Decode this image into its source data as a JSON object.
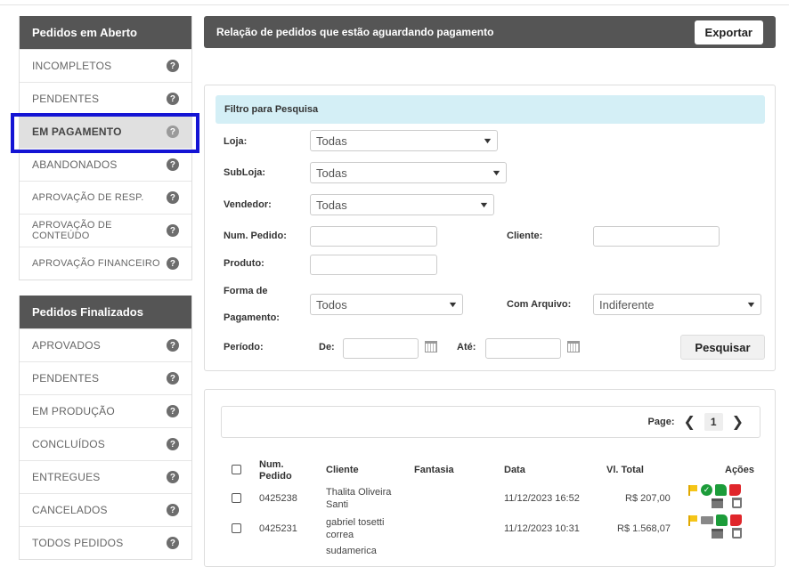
{
  "sidebar": {
    "open_orders": {
      "title": "Pedidos em Aberto",
      "items": [
        {
          "label": "INCOMPLETOS"
        },
        {
          "label": "PENDENTES"
        },
        {
          "label": "EM PAGAMENTO"
        },
        {
          "label": "ABANDONADOS"
        },
        {
          "label": "APROVAÇÃO DE RESP."
        },
        {
          "label": "APROVAÇÃO DE CONTEÚDO"
        },
        {
          "label": "APROVAÇÃO FINANCEIRO"
        }
      ]
    },
    "finished_orders": {
      "title": "Pedidos Finalizados",
      "items": [
        {
          "label": "APROVADOS"
        },
        {
          "label": "PENDENTES"
        },
        {
          "label": "EM PRODUÇÃO"
        },
        {
          "label": "CONCLUÍDOS"
        },
        {
          "label": "ENTREGUES"
        },
        {
          "label": "CANCELADOS"
        },
        {
          "label": "TODOS PEDIDOS"
        }
      ]
    },
    "help_glyph": "?",
    "active_item": "EM PAGAMENTO",
    "highlight_color": "#1414d4"
  },
  "header": {
    "title": "Relação de pedidos que estão aguardando pagamento",
    "export_label": "Exportar"
  },
  "filter": {
    "title": "Filtro para Pesquisa",
    "loja_label": "Loja:",
    "loja_value": "Todas",
    "subloja_label": "SubLoja:",
    "subloja_value": "Todas",
    "vendedor_label": "Vendedor:",
    "vendedor_value": "Todas",
    "num_pedido_label": "Num. Pedido:",
    "num_pedido_value": "",
    "cliente_label": "Cliente:",
    "cliente_value": "",
    "produto_label": "Produto:",
    "produto_value": "",
    "forma_pagamento_label_1": "Forma de",
    "forma_pagamento_label_2": "Pagamento:",
    "forma_pagamento_value": "Todos",
    "com_arquivo_label": "Com Arquivo:",
    "com_arquivo_value": "Indiferente",
    "periodo_label": "Período:",
    "de_label": "De:",
    "ate_label": "Até:",
    "search_label": "Pesquisar"
  },
  "results": {
    "pager": {
      "label": "Page:",
      "current": "1",
      "prev": "❮",
      "next": "❯"
    },
    "columns": {
      "num_pedido_1": "Num.",
      "num_pedido_2": "Pedido",
      "cliente": "Cliente",
      "fantasia": "Fantasia",
      "data": "Data",
      "vl_total": "Vl. Total",
      "acoes": "Ações"
    },
    "rows": [
      {
        "num": "0425238",
        "cliente_1": "Thalita Oliveira",
        "cliente_2": "Santi",
        "fantasia": "",
        "data": "11/12/2023 16:52",
        "total": "R$ 207,00"
      },
      {
        "num": "0425231",
        "cliente_1": "gabriel tosetti",
        "cliente_2": "correa",
        "fantasia": "",
        "data": "11/12/2023 10:31",
        "total": "R$ 1.568,07"
      }
    ],
    "partial_row_text": "sudamerica"
  },
  "colors": {
    "dark_header": "#555555",
    "filter_title_bg": "#d4eff6",
    "approve_green": "#1c9c3a",
    "reject_red": "#e0262b",
    "flag_yellow": "#f5c518"
  }
}
